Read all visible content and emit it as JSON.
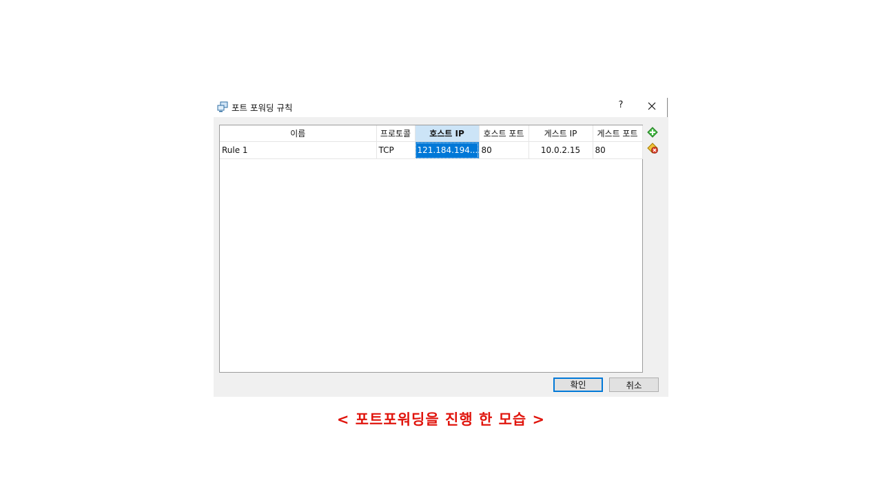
{
  "window": {
    "title": "포트 포워딩 규칙",
    "help_label": "?",
    "close_label": "✕"
  },
  "table": {
    "columns": [
      "이름",
      "프로토콜",
      "호스트 IP",
      "호스트 포트",
      "게스트 IP",
      "게스트 포트"
    ],
    "sorted_column": "호스트 IP",
    "rows": [
      {
        "name": "Rule 1",
        "protocol": "TCP",
        "host_ip": "121.184.194....",
        "host_port": "80",
        "guest_ip": "10.0.2.15",
        "guest_port": "80"
      }
    ]
  },
  "side_buttons": {
    "add_icon": "add-rule-icon",
    "remove_icon": "remove-rule-icon"
  },
  "buttons": {
    "ok": "확인",
    "cancel": "취소"
  },
  "caption": "< 포트포워딩을 진행 한 모습 >",
  "colors": {
    "selection": "#0078d7",
    "sorted_header": "#cce4f7",
    "caption": "#e0140c",
    "add_icon": "#2e9e2e",
    "remove_icon": "#d9402b"
  }
}
